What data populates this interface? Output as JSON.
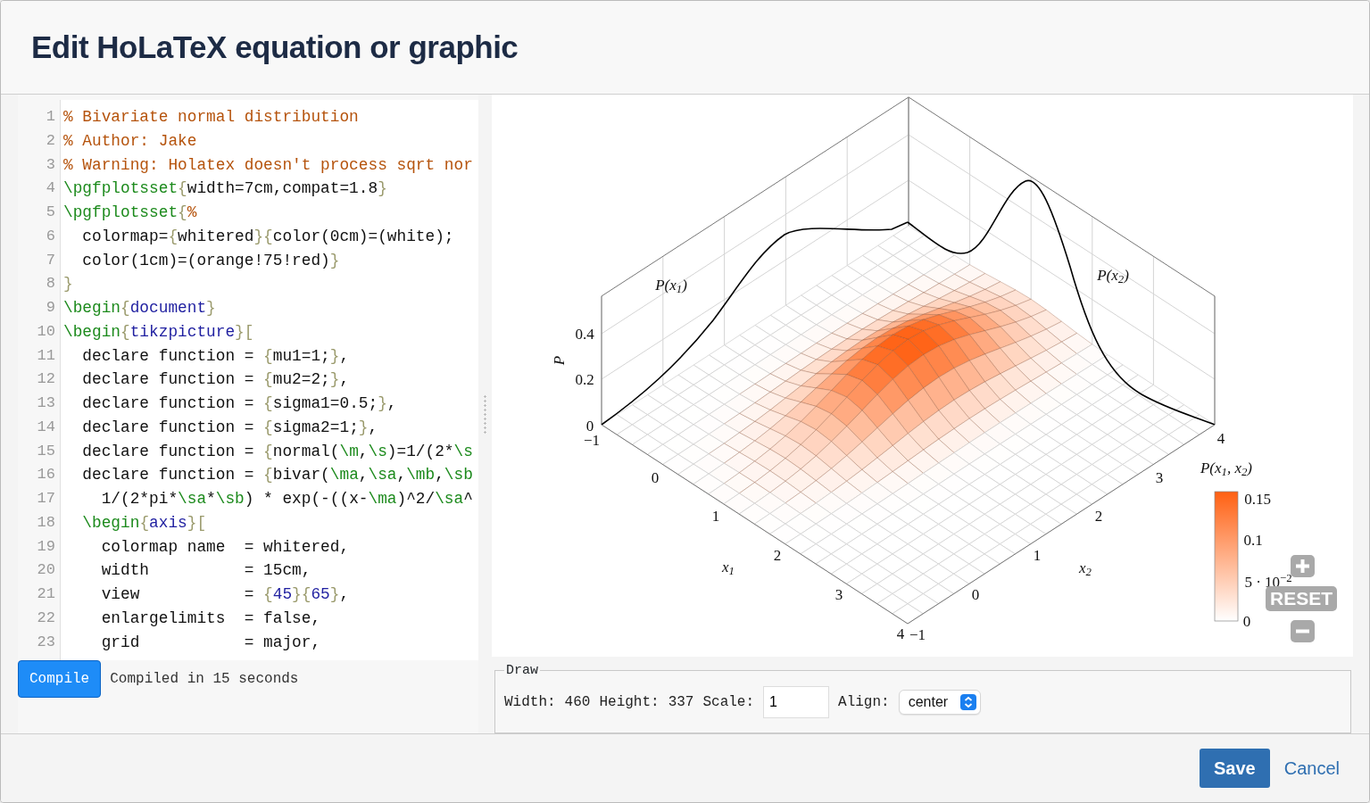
{
  "dialog": {
    "title": "Edit HoLaTeX equation or graphic"
  },
  "editor": {
    "lines": [
      {
        "number": "1",
        "tokens": [
          {
            "kind": "comment",
            "text": "% Bivariate normal distribution"
          }
        ]
      },
      {
        "number": "2",
        "tokens": [
          {
            "kind": "comment",
            "text": "% Author: Jake"
          }
        ]
      },
      {
        "number": "3",
        "tokens": [
          {
            "kind": "comment",
            "text": "% Warning: Holatex doesn't process sqrt nor"
          }
        ]
      },
      {
        "number": "4",
        "tokens": [
          {
            "kind": "command",
            "text": "\\pgfplotsset"
          },
          {
            "kind": "brace",
            "text": "{"
          },
          {
            "kind": "plain",
            "text": "width=7cm,compat=1.8"
          },
          {
            "kind": "brace",
            "text": "}"
          }
        ]
      },
      {
        "number": "5",
        "tokens": [
          {
            "kind": "command",
            "text": "\\pgfplotsset"
          },
          {
            "kind": "brace",
            "text": "{"
          },
          {
            "kind": "comment",
            "text": "%"
          }
        ]
      },
      {
        "number": "6",
        "tokens": [
          {
            "kind": "plain",
            "text": "  colormap="
          },
          {
            "kind": "brace",
            "text": "{"
          },
          {
            "kind": "plain",
            "text": "whitered"
          },
          {
            "kind": "brace",
            "text": "}{"
          },
          {
            "kind": "plain",
            "text": "color(0cm)=(white);"
          }
        ]
      },
      {
        "number": "7",
        "tokens": [
          {
            "kind": "plain",
            "text": "  color(1cm)=(orange!75!red)"
          },
          {
            "kind": "brace",
            "text": "}"
          }
        ]
      },
      {
        "number": "8",
        "tokens": [
          {
            "kind": "brace",
            "text": "}"
          }
        ]
      },
      {
        "number": "9",
        "tokens": [
          {
            "kind": "command",
            "text": "\\begin"
          },
          {
            "kind": "brace",
            "text": "{"
          },
          {
            "kind": "name",
            "text": "document"
          },
          {
            "kind": "brace",
            "text": "}"
          }
        ]
      },
      {
        "number": "10",
        "tokens": [
          {
            "kind": "command",
            "text": "\\begin"
          },
          {
            "kind": "brace",
            "text": "{"
          },
          {
            "kind": "name",
            "text": "tikzpicture"
          },
          {
            "kind": "brace",
            "text": "}["
          }
        ]
      },
      {
        "number": "11",
        "tokens": [
          {
            "kind": "plain",
            "text": "  declare function = "
          },
          {
            "kind": "brace",
            "text": "{"
          },
          {
            "kind": "plain",
            "text": "mu1=1;"
          },
          {
            "kind": "brace",
            "text": "}"
          },
          {
            "kind": "plain",
            "text": ","
          }
        ]
      },
      {
        "number": "12",
        "tokens": [
          {
            "kind": "plain",
            "text": "  declare function = "
          },
          {
            "kind": "brace",
            "text": "{"
          },
          {
            "kind": "plain",
            "text": "mu2=2;"
          },
          {
            "kind": "brace",
            "text": "}"
          },
          {
            "kind": "plain",
            "text": ","
          }
        ]
      },
      {
        "number": "13",
        "tokens": [
          {
            "kind": "plain",
            "text": "  declare function = "
          },
          {
            "kind": "brace",
            "text": "{"
          },
          {
            "kind": "plain",
            "text": "sigma1=0.5;"
          },
          {
            "kind": "brace",
            "text": "}"
          },
          {
            "kind": "plain",
            "text": ","
          }
        ]
      },
      {
        "number": "14",
        "tokens": [
          {
            "kind": "plain",
            "text": "  declare function = "
          },
          {
            "kind": "brace",
            "text": "{"
          },
          {
            "kind": "plain",
            "text": "sigma2=1;"
          },
          {
            "kind": "brace",
            "text": "}"
          },
          {
            "kind": "plain",
            "text": ","
          }
        ]
      },
      {
        "number": "15",
        "tokens": [
          {
            "kind": "plain",
            "text": "  declare function = "
          },
          {
            "kind": "brace",
            "text": "{"
          },
          {
            "kind": "plain",
            "text": "normal("
          },
          {
            "kind": "command",
            "text": "\\m"
          },
          {
            "kind": "plain",
            "text": ","
          },
          {
            "kind": "command",
            "text": "\\s"
          },
          {
            "kind": "plain",
            "text": ")=1/(2*"
          },
          {
            "kind": "command",
            "text": "\\s"
          }
        ]
      },
      {
        "number": "16",
        "tokens": [
          {
            "kind": "plain",
            "text": "  declare function = "
          },
          {
            "kind": "brace",
            "text": "{"
          },
          {
            "kind": "plain",
            "text": "bivar("
          },
          {
            "kind": "command",
            "text": "\\ma"
          },
          {
            "kind": "plain",
            "text": ","
          },
          {
            "kind": "command",
            "text": "\\sa"
          },
          {
            "kind": "plain",
            "text": ","
          },
          {
            "kind": "command",
            "text": "\\mb"
          },
          {
            "kind": "plain",
            "text": ","
          },
          {
            "kind": "command",
            "text": "\\sb"
          }
        ]
      },
      {
        "number": "17",
        "tokens": [
          {
            "kind": "plain",
            "text": "    1/(2*pi*"
          },
          {
            "kind": "command",
            "text": "\\sa"
          },
          {
            "kind": "plain",
            "text": "*"
          },
          {
            "kind": "command",
            "text": "\\sb"
          },
          {
            "kind": "plain",
            "text": ") * exp(-((x-"
          },
          {
            "kind": "command",
            "text": "\\ma"
          },
          {
            "kind": "plain",
            "text": ")^2/"
          },
          {
            "kind": "command",
            "text": "\\sa"
          },
          {
            "kind": "plain",
            "text": "^"
          }
        ]
      },
      {
        "number": "18",
        "tokens": [
          {
            "kind": "command",
            "text": "  \\begin"
          },
          {
            "kind": "brace",
            "text": "{"
          },
          {
            "kind": "name",
            "text": "axis"
          },
          {
            "kind": "brace",
            "text": "}["
          }
        ]
      },
      {
        "number": "19",
        "tokens": [
          {
            "kind": "plain",
            "text": "    colormap name  = whitered,"
          }
        ]
      },
      {
        "number": "20",
        "tokens": [
          {
            "kind": "plain",
            "text": "    width          = 15cm,"
          }
        ]
      },
      {
        "number": "21",
        "tokens": [
          {
            "kind": "plain",
            "text": "    view           = "
          },
          {
            "kind": "brace",
            "text": "{"
          },
          {
            "kind": "name",
            "text": "45"
          },
          {
            "kind": "brace",
            "text": "}{"
          },
          {
            "kind": "name",
            "text": "65"
          },
          {
            "kind": "brace",
            "text": "}"
          },
          {
            "kind": "plain",
            "text": ","
          }
        ]
      },
      {
        "number": "22",
        "tokens": [
          {
            "kind": "plain",
            "text": "    enlargelimits  = false,"
          }
        ]
      },
      {
        "number": "23",
        "tokens": [
          {
            "kind": "plain",
            "text": "    grid           = major,"
          }
        ]
      }
    ]
  },
  "compile": {
    "button": "Compile",
    "status": "Compiled in 15 seconds"
  },
  "graphic": {
    "labels": [
      {
        "kind": "curve_label",
        "text": "P(x$_{1}$)"
      },
      {
        "kind": "curve_label",
        "text": "P(x$_{2}$)"
      },
      {
        "kind": "tick",
        "text": "0.4"
      },
      {
        "kind": "tick",
        "text": "0.2"
      },
      {
        "kind": "tick",
        "text": "0"
      },
      {
        "kind": "axis_label_vertical",
        "text": "P"
      },
      {
        "kind": "tick",
        "text": "−1"
      },
      {
        "kind": "tick",
        "text": "0"
      },
      {
        "kind": "tick",
        "text": "1"
      },
      {
        "kind": "tick",
        "text": "2"
      },
      {
        "kind": "tick",
        "text": "3"
      },
      {
        "kind": "tick",
        "text": "4"
      },
      {
        "kind": "axis_label",
        "text": "x$_{1}$"
      },
      {
        "kind": "tick",
        "text": "−1"
      },
      {
        "kind": "tick",
        "text": "0"
      },
      {
        "kind": "tick",
        "text": "1"
      },
      {
        "kind": "tick",
        "text": "2"
      },
      {
        "kind": "tick",
        "text": "3"
      },
      {
        "kind": "tick",
        "text": "4"
      },
      {
        "kind": "axis_label",
        "text": "x$_{2}$"
      },
      {
        "kind": "axis_label",
        "text": "P(x$_{1}$, x$_{2}$)"
      },
      {
        "kind": "tick",
        "text": "0.15"
      },
      {
        "kind": "tick",
        "text": "0.1"
      },
      {
        "kind": "tick",
        "text": "5 · 10$^{−2}$"
      },
      {
        "kind": "tick",
        "text": "0"
      }
    ],
    "reset_button": "RESET"
  },
  "draw": {
    "legend": "Draw",
    "fields": [
      {
        "label": "Width:",
        "value": "460"
      },
      {
        "label": "Height:",
        "value": "337"
      }
    ],
    "scale_label": "Scale:",
    "scale": "1",
    "align_label": "Align:",
    "align": "center"
  },
  "footer": {
    "save": "Save",
    "cancel": "Cancel"
  }
}
